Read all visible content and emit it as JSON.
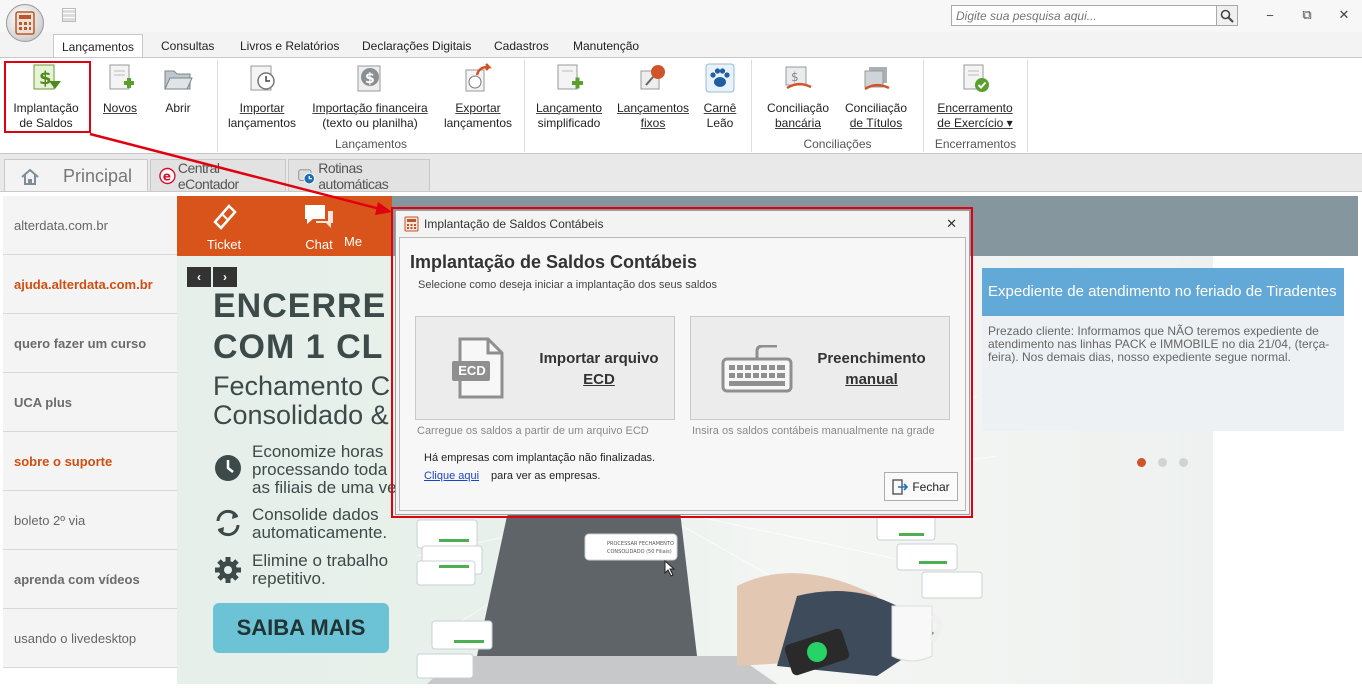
{
  "search": {
    "placeholder": "Digite sua pesquisa aqui..."
  },
  "window": {
    "minimize": "−",
    "restore": "⧉",
    "close": "✕"
  },
  "ribbon_tabs": [
    "Lançamentos",
    "Consultas",
    "Livros e Relatórios",
    "Declarações Digitais",
    "Cadastros",
    "Manutenção"
  ],
  "ribbon": {
    "buttons": {
      "implantacao": {
        "l1": "Implantação",
        "l2": "de Saldos"
      },
      "novos": {
        "l1": "Novos"
      },
      "abrir": {
        "l1": "Abrir"
      },
      "importar": {
        "l1": "Importar",
        "l2": "lançamentos"
      },
      "imp_fin": {
        "l1": "Importação financeira",
        "l2": "(texto ou planilha)"
      },
      "exportar": {
        "l1": "Exportar",
        "l2": "lançamentos"
      },
      "lanc_simp": {
        "l1": "Lançamento",
        "l2": "simplificado"
      },
      "lanc_fixos": {
        "l1": "Lançamentos",
        "l2": "fixos"
      },
      "carne": {
        "l1": "Carnê",
        "l2": "Leão"
      },
      "conc_banc": {
        "l1": "Conciliação",
        "l2": "bancária"
      },
      "conc_tit": {
        "l1": "Conciliação",
        "l2": "de Títulos"
      },
      "encerramento": {
        "l1": "Encerramento",
        "l2": "de Exercício ▾"
      }
    },
    "groups": {
      "lancamentos": "Lançamentos",
      "conciliacoes": "Conciliações",
      "encerramentos": "Encerramentos"
    }
  },
  "page_tabs": {
    "principal": "Principal",
    "central": "Central eContador",
    "rotinas": "Rotinas automáticas"
  },
  "sidebar": {
    "items": [
      {
        "label": "alterdata.com.br"
      },
      {
        "label": "ajuda.alterdata.com.br"
      },
      {
        "label": "quero fazer um curso"
      },
      {
        "label": "UCA plus"
      },
      {
        "label": "sobre o suporte"
      },
      {
        "label": "boleto 2º via"
      },
      {
        "label": "aprenda com vídeos"
      },
      {
        "label": "usando o livedesktop"
      }
    ]
  },
  "support_bar": {
    "ticket": "Ticket",
    "chat": "Chat",
    "more": "Me"
  },
  "hero": {
    "h1": "ENCERRE",
    "h2": "COM 1 CL",
    "s1": "Fechamento C",
    "s2": "Consolidado &",
    "f1a": "Economize horas",
    "f1b": "processando toda",
    "f1c": "as filiais de uma ve",
    "f2a": "Consolide dados",
    "f2b": "automaticamente.",
    "f3a": "Elimine o trabalho",
    "f3b": "repetitivo.",
    "cta": "SAIBA MAIS",
    "card_text": "PROCESSAR FECHAMENTO CONSOLIDADO (50 Filiais)"
  },
  "news": {
    "title": "Expediente de atendimento no feriado de Tiradentes",
    "body": "Prezado cliente: Informamos que NÃO teremos expediente de atendimento nas linhas PACK e IMMOBILE no dia 21/04, (terça-feira). Nos demais dias, nosso expediente segue normal."
  },
  "dialog": {
    "window_title": "Implantação de Saldos Contábeis",
    "heading": "Implantação de Saldos Contábeis",
    "subtitle": "Selecione como deseja iniciar a implantação dos seus saldos",
    "option_ecd": {
      "l1": "Importar arquivo",
      "l2": "ECD",
      "desc": "Carregue os saldos a partir de um arquivo ECD",
      "badge": "ECD"
    },
    "option_manual": {
      "l1": "Preenchimento",
      "l2": "manual",
      "desc": "Insira os saldos contábeis manualmente na grade"
    },
    "note": "Há empresas com implantação não finalizadas.",
    "link": "Clique aqui",
    "link_rest": "para ver as empresas.",
    "close_button": "Fechar"
  },
  "colors": {
    "accent_red": "#e00010",
    "orange": "#d9541a",
    "news_blue": "#62a9d7",
    "cta": "#6cc3d6"
  }
}
